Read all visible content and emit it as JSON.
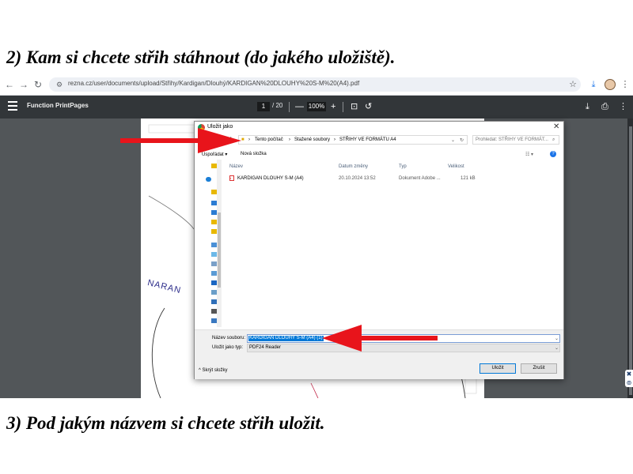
{
  "captions": {
    "top": "2) Kam si chcete střih stáhnout (do jakého uložiště).",
    "bottom": "3) Pod jakým názvem si chcete střih uložit."
  },
  "browser": {
    "url_host": "rezna.cz",
    "url_path": "/user/documents/upload/Střihy/Kardigan/Dlouhý/KARDIGAN%20DLOUHY%20S-M%20(A4).pdf"
  },
  "pdf_viewer": {
    "title": "Function PrintPages",
    "page_current": "1",
    "page_total": "/ 20",
    "zoom": "100%",
    "rotated_text": "NARAN"
  },
  "dialog": {
    "title": "Uložit jako",
    "path": [
      "Tento počítač",
      "Stažené soubory",
      "STŘIHY VE FORMÁTU A4"
    ],
    "search_placeholder": "Prohledat: STŘIHY VE FORMÁT...",
    "organize": "Uspořádat ▾",
    "new_folder": "Nová složka",
    "columns": [
      "Název",
      "Datum změny",
      "Typ",
      "Velikost"
    ],
    "file": {
      "name": "KARDIGAN DLOUHY S-M (A4)",
      "date": "20.10.2024 13:52",
      "type": "Dokument Adobe ...",
      "size": "121 kB"
    },
    "filename_label": "Název souboru:",
    "filename_value": "KARDIGAN DLOUHY S-M (A4) (1)",
    "filetype_label": "Uložit jako typ:",
    "filetype_value": "PDF24 Reader",
    "hide_folders": "Skrýt složky",
    "save": "Uložit",
    "cancel": "Zrušit"
  },
  "colors": {
    "arrow": "#e8141b",
    "pdf_toolbar": "#323639",
    "viewer_bg": "#525659",
    "selection": "#0078d7"
  }
}
